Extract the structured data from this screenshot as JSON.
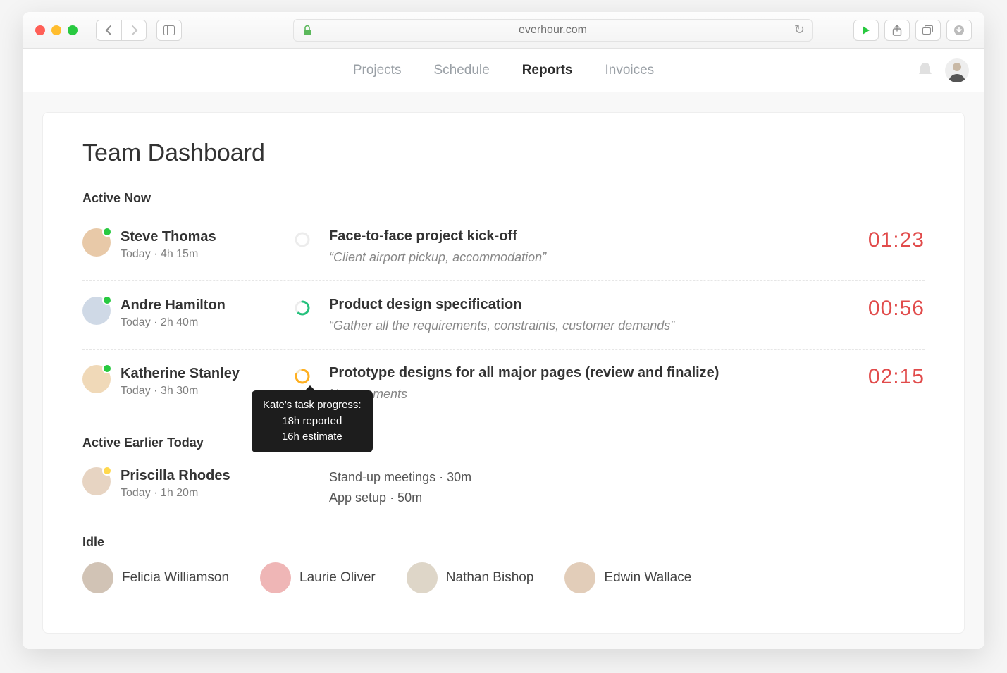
{
  "browser": {
    "url": "everhour.com"
  },
  "nav": {
    "items": [
      "Projects",
      "Schedule",
      "Reports",
      "Invoices"
    ],
    "active_index": 2
  },
  "page": {
    "title": "Team Dashboard"
  },
  "sections": {
    "active_now": {
      "title": "Active Now",
      "rows": [
        {
          "name": "Steve Thomas",
          "meta": "Today ·  4h 15m",
          "task": "Face-to-face project kick-off",
          "note": "“Client airport pickup, accommodation”",
          "timer": "01:23",
          "ring_color": "#e6e6e6",
          "ring_pct": 0
        },
        {
          "name": "Andre Hamilton",
          "meta": "Today ·  2h 40m",
          "task": "Product design specification",
          "note": "“Gather all the requirements, constraints, customer demands”",
          "timer": "00:56",
          "ring_color": "#24c17c",
          "ring_pct": 60
        },
        {
          "name": "Katherine Stanley",
          "meta": "Today ·  3h 30m",
          "task": "Prototype designs for all major pages (review and finalize)",
          "note": "No comments",
          "timer": "02:15",
          "ring_color": "#ffb020",
          "ring_pct": 80,
          "tooltip": {
            "l1": "Kate's task progress:",
            "l2": "18h reported",
            "l3": "16h estimate"
          }
        }
      ]
    },
    "earlier": {
      "title": "Active Earlier Today",
      "rows": [
        {
          "name": "Priscilla Rhodes",
          "meta": "Today ·  1h 20m",
          "tasks": [
            "Stand-up meetings ·  30m",
            "App setup ·  50m"
          ]
        }
      ]
    },
    "idle": {
      "title": "Idle",
      "people": [
        "Felicia Williamson",
        "Laurie Oliver",
        "Nathan Bishop",
        "Edwin Wallace"
      ]
    }
  }
}
